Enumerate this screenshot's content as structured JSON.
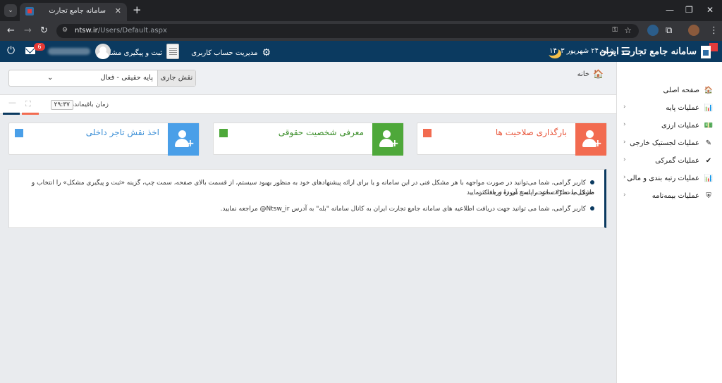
{
  "browser": {
    "tab_title": "سامانه جامع تجارت",
    "url_host": "ntsw.ir",
    "url_path": "/Users/Default.aspx"
  },
  "header": {
    "brand_name": "سامانه جامع تجارت ایران",
    "date": "شنبه ۲۴ شهریور ۱۴۰۳",
    "account_mgmt": "مدیریت حساب کاربری",
    "issue_tracking": "ثبت و پیگیری مشکل",
    "notification_count": "6"
  },
  "sidebar": {
    "items": [
      {
        "label": "صفحه اصلی",
        "icon": "home-icon",
        "glyph": "🏠"
      },
      {
        "label": "عملیات پایه",
        "icon": "chart-icon",
        "glyph": "📊"
      },
      {
        "label": "عملیات ارزی",
        "icon": "money-icon",
        "glyph": "💵"
      },
      {
        "label": "عملیات لجستیک خارجی",
        "icon": "edit-icon",
        "glyph": "✎"
      },
      {
        "label": "عملیات گمرکی",
        "icon": "check-icon",
        "glyph": "✔"
      },
      {
        "label": "عملیات رتبه بندی و مالی",
        "icon": "chart-icon",
        "glyph": "📊"
      },
      {
        "label": "عملیات بیمه‌نامه",
        "icon": "shield-icon",
        "glyph": "⛨"
      }
    ]
  },
  "breadcrumb": {
    "home": "خانه"
  },
  "role": {
    "label": "نقش جاری",
    "value": "پایه حقیقی - فعال"
  },
  "timer": {
    "label": "زمان باقیمانده",
    "value": "۲۹:۳۷"
  },
  "cards": [
    {
      "title": "بارگذاری صلاحیت ها",
      "color": "#f26b50",
      "text_color": "#e8553a"
    },
    {
      "title": "معرفی شخصیت حقوقی",
      "color": "#4ea83a",
      "text_color": "#3d8f2c"
    },
    {
      "title": "اخذ نقش تاجر داخلی",
      "color": "#4a9fe8",
      "text_color": "#3a8ed6"
    }
  ],
  "notices": [
    {
      "line1": "کاربر گرامی، شما می‌توانید در صورت مواجهه با هر مشکل فنی در این سامانه و یا برای ارائه پیشنهادهای خود به منظور بهبود سیستم، از قسمت بالای صفحه، سمت چپ، گزینه «ثبت و پیگیری مشکل» را انتخاب و مشکل یا نظرات خود را ثبت نموده و حداکثر",
      "line2": "ظرف مدت ۲۴ ساعت، پاسخ آن را دریافت نمایید"
    },
    {
      "line1": "کاربر گرامی، شما می توانید جهت دریافت اطلاعیه های سامانه جامع تجارت ایران به کانال سامانه \"بله\" به آدرس Ntsw_ir@ مراجعه نمایید."
    }
  ]
}
